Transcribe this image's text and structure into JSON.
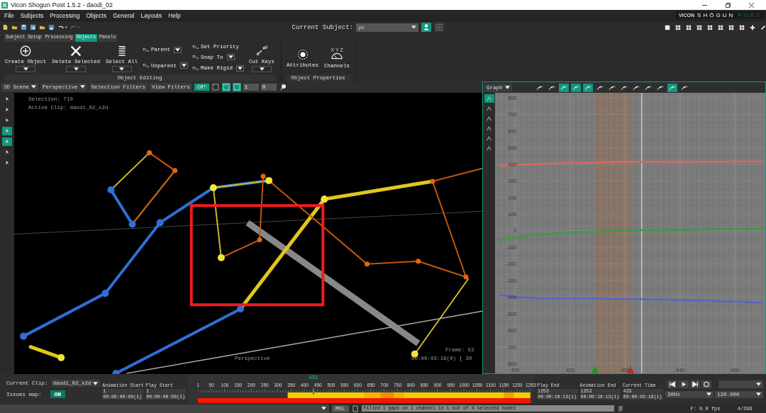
{
  "window": {
    "title": "Vicon Shogun Post 1.5.2  - daodi_02"
  },
  "menu": [
    "File",
    "Subjects",
    "Processing",
    "Objects",
    "General",
    "Layouts",
    "Help"
  ],
  "logo": {
    "brand": "VICON",
    "product": "SHŌGUN",
    "suffix": "POST"
  },
  "toolbar": {
    "subject_label": "Current Subject:",
    "subject": "yc"
  },
  "ribbon_tabs": [
    {
      "label": "Subject Setup",
      "selected": false
    },
    {
      "label": "Processing",
      "selected": false
    },
    {
      "label": "Objects",
      "selected": true
    },
    {
      "label": "Panels",
      "selected": false
    }
  ],
  "ribbon": [
    {
      "label": "Object Editing",
      "columns": [
        [
          {
            "kind": "large",
            "label": "Create Object",
            "dropdown": true
          }
        ],
        [
          {
            "kind": "large",
            "label": "Delete Selected",
            "dropdown": true
          }
        ],
        [
          {
            "kind": "large",
            "label": "Select All",
            "dropdown": true
          }
        ],
        [
          {
            "kind": "small",
            "label": "Parent",
            "dropdown": true
          },
          {
            "kind": "small",
            "label": "Unparent",
            "dropdown": true
          }
        ],
        [
          {
            "kind": "small",
            "label": "Set Priority",
            "dropdown": false
          },
          {
            "kind": "small",
            "label": "Snap To",
            "dropdown": true
          },
          {
            "kind": "small",
            "label": "Make Rigid",
            "dropdown": true
          }
        ],
        [
          {
            "kind": "large",
            "label": "Cut Keys",
            "dropdown": true
          }
        ]
      ]
    },
    {
      "label": "Object Properties",
      "columns": [
        [
          {
            "kind": "large",
            "label": "Attributes",
            "dropdown": false
          }
        ],
        [
          {
            "kind": "large",
            "label": "Channels",
            "dropdown": false,
            "icon_text": "X Y Z"
          }
        ]
      ]
    }
  ],
  "viewport": {
    "menus": [
      "3D Scene",
      "Perspective"
    ],
    "buttons": [
      "Selection Filters",
      "View Filters"
    ],
    "camera_mode": "CH*",
    "field_1": "1",
    "field_2": "0",
    "tools": [
      {
        "selected": false
      },
      {
        "selected": true
      },
      {
        "selected": true
      }
    ],
    "side_tools": [
      {
        "selected": false
      },
      {
        "selected": false
      },
      {
        "selected": false
      },
      {
        "selected": true
      },
      {
        "selected": true
      },
      {
        "selected": false
      },
      {
        "selected": false
      }
    ],
    "info": [
      "Selection: T10",
      "Active Clip: daodi_02_x2d"
    ],
    "camera_label": "Perspective",
    "frame_label": "Frame: 53",
    "timecode": "00:00:03:18(0) [ 30"
  },
  "graph": {
    "view": "Graph",
    "tools": [
      {
        "selected": false
      },
      {
        "selected": false
      },
      {
        "selected": true
      },
      {
        "selected": true
      },
      {
        "selected": true
      },
      {
        "selected": false
      },
      {
        "selected": false
      },
      {
        "selected": false
      },
      {
        "selected": false
      },
      {
        "selected": false
      },
      {
        "selected": false
      },
      {
        "selected": true
      },
      {
        "selected": false
      }
    ],
    "side_tools": [
      {
        "selected": true
      },
      {
        "selected": false
      },
      {
        "selected": false
      },
      {
        "selected": false
      },
      {
        "selected": false
      },
      {
        "selected": false
      }
    ],
    "chart_data": {
      "type": "line",
      "x": [
        407,
        410,
        414,
        418,
        422,
        426,
        430,
        433,
        440,
        445,
        450,
        455
      ],
      "series": [
        {
          "color": "#d9675e",
          "values": [
            390,
            395,
            400,
            405,
            408,
            412,
            415,
            415,
            414,
            415,
            416,
            417
          ]
        },
        {
          "color": "#3f9a3f",
          "values": [
            -60,
            -40,
            -25,
            -15,
            -8,
            -3,
            0,
            2,
            3,
            6,
            8,
            10
          ]
        },
        {
          "color": "#5a63c8",
          "values": [
            -390,
            -400,
            -407,
            -410,
            -410,
            -410,
            -413,
            -413,
            -418,
            -423,
            -428,
            -435
          ]
        }
      ],
      "xlim": [
        406.3,
        455.5
      ],
      "ylim": [
        -860,
        830
      ],
      "grid": true,
      "ref_lines": [
        {
          "axis": "x",
          "value": 433
        }
      ],
      "xticks": [
        410,
        420,
        430,
        440,
        450
      ],
      "yticks": [
        800,
        700,
        600,
        500,
        400,
        300,
        200,
        100,
        0,
        -100,
        -200,
        -300,
        -400,
        -500,
        -600,
        -700,
        -800
      ]
    }
  },
  "clip": {
    "label": "Current Clip:",
    "value": "daodi_02_x2d"
  },
  "issues": {
    "label": "Issues map:",
    "toggle": "ON",
    "on": true
  },
  "left_ranges": [
    {
      "label": "Animation Start",
      "frame": "1",
      "timecode": "00:00:00:00(1)"
    },
    {
      "label": "Play Start",
      "frame": "1",
      "timecode": "00:00:00:00(1)"
    }
  ],
  "timeline": {
    "ticks": [
      "1",
      "50",
      "100",
      "150",
      "200",
      "250",
      "300",
      "350",
      "400",
      "450",
      "500",
      "550",
      "600",
      "650",
      "700",
      "750",
      "800",
      "850",
      "900",
      "950",
      "1000",
      "1050",
      "1100",
      "1150",
      "1200",
      "1253"
    ],
    "current": "433",
    "level": 0.345
  },
  "right_ranges": [
    {
      "label": "Play End",
      "frame": "1253",
      "timecode": "00:00:10:13(1)"
    },
    {
      "label": "Animation End",
      "frame": "1253",
      "timecode": "00:00:10:13(1)"
    },
    {
      "label": "Current Time",
      "frame": "433",
      "timecode": "00:00:03:18(1)"
    }
  ],
  "playback": {
    "rate": "30Hz",
    "speed": "120.000"
  },
  "status": {
    "mode": "MSL",
    "message": "Filled 1 gaps on 1 channel in 1 out of 4 selected nodes",
    "fps": "F: 0.0 fps",
    "count": "4/356"
  }
}
